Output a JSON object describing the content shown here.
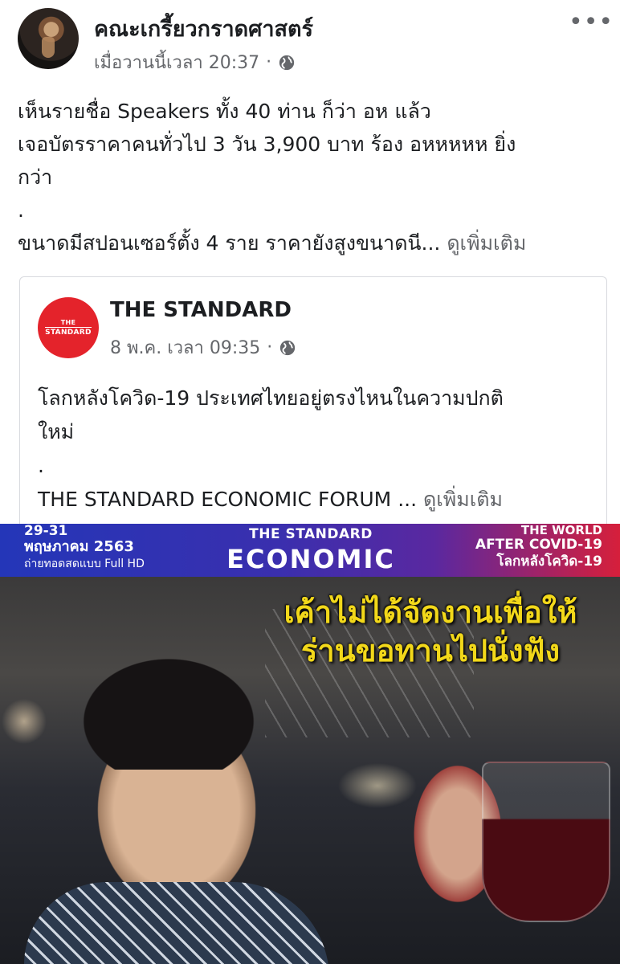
{
  "post": {
    "author": "คณะเกรี้ยวกราดศาสตร์",
    "timestamp": "เมื่อวานนี้เวลา 20:37",
    "separator": "·",
    "privacy_icon": "globe-icon",
    "more_label": "•••",
    "text_lines": [
      "เห็นรายชื่อ Speakers ทั้ง 40 ท่าน ก็ว่า อห แล้ว",
      "เจอบัตรราคาคนทั่วไป 3 วัน 3,900 บาท ร้อง อหหหหห ยิ่ง",
      "กว่า",
      ".",
      "ขนาดมีสปอนเซอร์ตั้ง 4 ราย ราคายังสูงขนาดนี..."
    ],
    "see_more": "ดูเพิ่มเติม"
  },
  "shared": {
    "logo_line1": "THE",
    "logo_line2": "STANDARD",
    "name": "THE STANDARD",
    "timestamp": "8 พ.ค. เวลา 09:35",
    "separator": "·",
    "privacy_icon": "globe-icon",
    "text_lines": [
      "โลกหลังโควิด-19 ประเทศไทยอยู่ตรงไหนในความปกติ",
      "ใหม่",
      ".",
      "THE STANDARD ECONOMIC FORUM ..."
    ],
    "see_more": "ดูเพิ่มเติม"
  },
  "banner": {
    "dates": "29-31",
    "month": "พฤษภาคม 2563",
    "live": "ถ่ายทอดสดแบบ Full HD",
    "std": "THE STANDARD",
    "econ": "ECONOMIC",
    "world": "THE WORLD",
    "after": "AFTER COVID-19",
    "thai": "โลกหลังโควิด-19"
  },
  "meme": {
    "caption_line1": "เค้าไม่ได้จัดงานเพื่อให้",
    "caption_line2": "ร่านขอทานไปนั่งฟัง"
  },
  "colors": {
    "text": "#1c1e21",
    "secondary": "#65676b",
    "brand_red": "#e4232b",
    "caption_yellow": "#f2d81a"
  }
}
